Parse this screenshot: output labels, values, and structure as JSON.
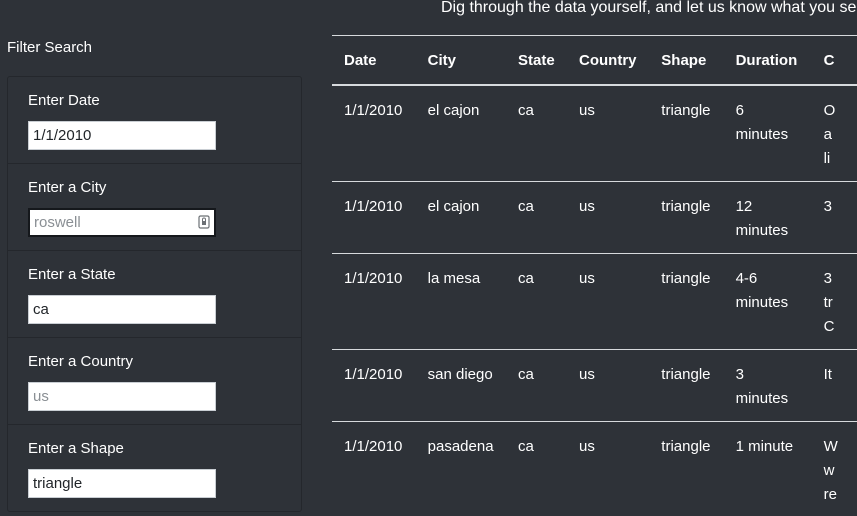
{
  "header": {
    "intro_text": "Dig through the data yourself, and let us know what you se"
  },
  "sidebar": {
    "title": "Filter Search",
    "filters": [
      {
        "label": "Enter Date",
        "value": "1/1/2010",
        "placeholder": ""
      },
      {
        "label": "Enter a City",
        "value": "",
        "placeholder": "roswell"
      },
      {
        "label": "Enter a State",
        "value": "ca",
        "placeholder": ""
      },
      {
        "label": "Enter a Country",
        "value": "",
        "placeholder": "us"
      },
      {
        "label": "Enter a Shape",
        "value": "triangle",
        "placeholder": ""
      }
    ]
  },
  "table": {
    "headers": [
      "Date",
      "City",
      "State",
      "Country",
      "Shape",
      "Duration",
      "C"
    ],
    "rows": [
      {
        "date": "1/1/2010",
        "city": "el cajon",
        "state": "ca",
        "country": "us",
        "shape": "triangle",
        "duration": "6 minutes",
        "comments": "O\na\nli"
      },
      {
        "date": "1/1/2010",
        "city": "el cajon",
        "state": "ca",
        "country": "us",
        "shape": "triangle",
        "duration": "12 minutes",
        "comments": "3"
      },
      {
        "date": "1/1/2010",
        "city": "la mesa",
        "state": "ca",
        "country": "us",
        "shape": "triangle",
        "duration": "4-6 minutes",
        "comments": "3\ntr\nC"
      },
      {
        "date": "1/1/2010",
        "city": "san diego",
        "state": "ca",
        "country": "us",
        "shape": "triangle",
        "duration": "3 minutes",
        "comments": "It"
      },
      {
        "date": "1/1/2010",
        "city": "pasadena",
        "state": "ca",
        "country": "us",
        "shape": "triangle",
        "duration": "1 minute",
        "comments": "W\nw\nre"
      }
    ]
  }
}
